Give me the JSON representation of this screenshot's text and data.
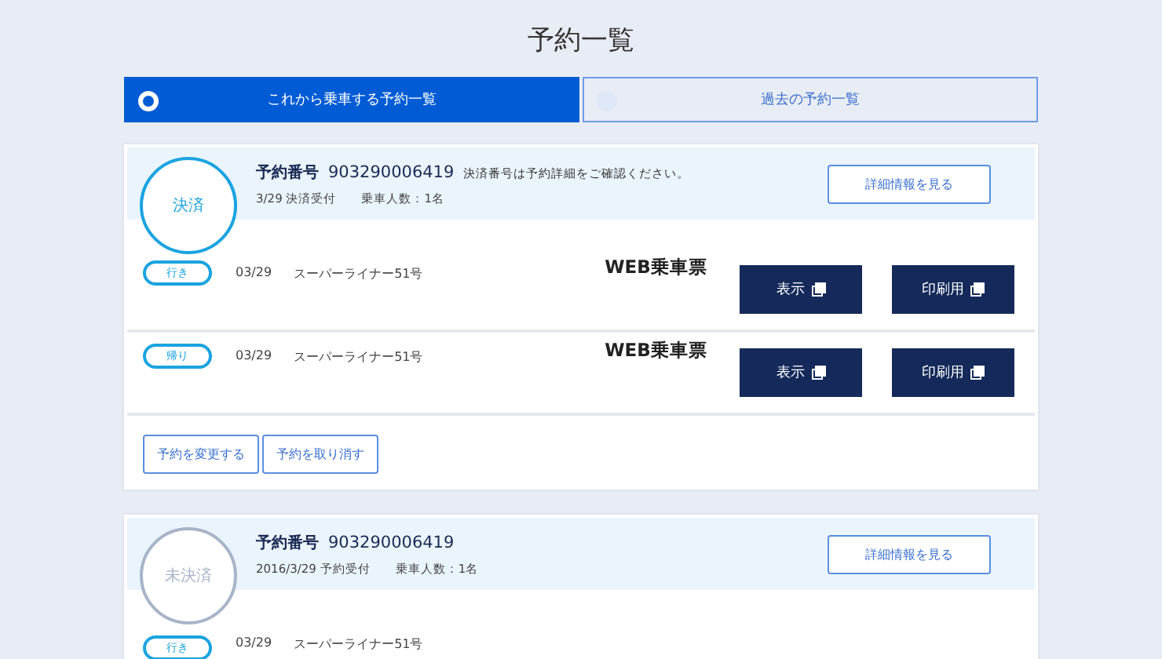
{
  "title": "予約一覧",
  "tabs": [
    {
      "label": "これから乗車する予約一覧",
      "selected": true
    },
    {
      "label": "過去の予約一覧",
      "selected": false
    }
  ],
  "reservations": [
    {
      "status": "決済",
      "paid": true,
      "number_label": "予約番号",
      "number": "903290006419",
      "note": "決済番号は予約詳細をご確認ください。",
      "received": "3/29 決済受付",
      "passengers": "乗車人数：1名",
      "detail_button": "詳細情報を見る",
      "legs": [
        {
          "direction": "行き",
          "date": "03/29",
          "train": "スーパーライナー51号",
          "ticket_label": "WEB乗車票",
          "buttons": [
            "表示",
            "印刷用"
          ]
        },
        {
          "direction": "帰り",
          "date": "03/29",
          "train": "スーパーライナー51号",
          "ticket_label": "WEB乗車票",
          "buttons": [
            "表示",
            "印刷用"
          ]
        }
      ],
      "actions": [
        "予約を変更する",
        "予約を取り消す"
      ]
    },
    {
      "status": "未決済",
      "paid": false,
      "number_label": "予約番号",
      "number": "903290006419",
      "received": "2016/3/29 予約受付",
      "passengers": "乗車人数：1名",
      "detail_button": "詳細情報を見る",
      "legs": [
        {
          "direction": "行き",
          "date": "03/29",
          "train": "スーパーライナー51号"
        }
      ]
    }
  ]
}
